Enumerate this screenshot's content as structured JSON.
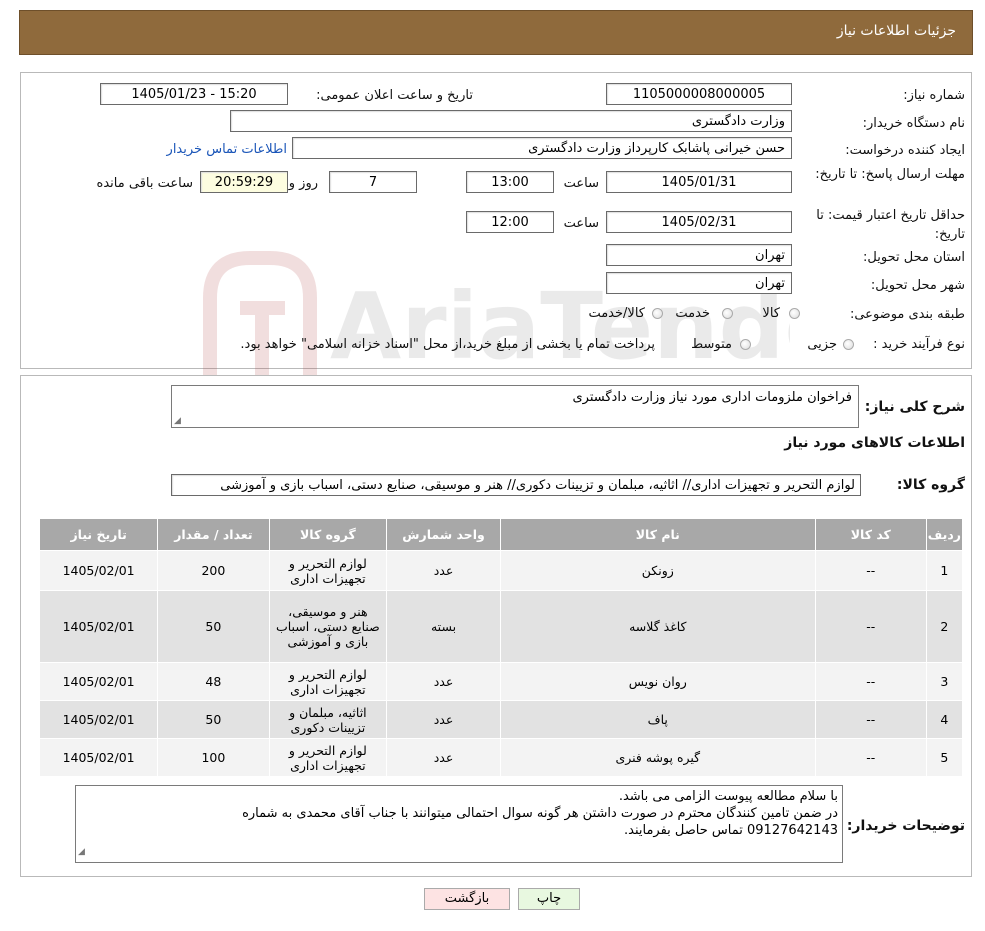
{
  "header": {
    "title": "جزئیات اطلاعات نیاز"
  },
  "watermark": {
    "text": "AriaTender.neT"
  },
  "form": {
    "need_number_label": "شماره نیاز:",
    "need_number": "1105000008000005",
    "announce_label": "تاریخ و ساعت اعلان عمومی:",
    "announce_value": "1405/01/23 - 15:20",
    "buyer_label": "نام دستگاه خریدار:",
    "buyer_value": "وزارت دادگستری",
    "requester_label": "ایجاد کننده درخواست:",
    "requester_value": "حسن خیرانی پاشابک کارپرداز وزارت دادگستری",
    "contact_link": "اطلاعات تماس خریدار",
    "deadline_label": "مهلت ارسال پاسخ: تا تاریخ:",
    "deadline_date": "1405/01/31",
    "time_label": "ساعت",
    "deadline_time": "13:00",
    "days_value": "7",
    "days_label": "روز و",
    "remaining_time": "20:59:29",
    "remaining_label": "ساعت باقی مانده",
    "validity_label": "حداقل تاریخ اعتبار قیمت: تا تاریخ:",
    "validity_date": "1405/02/31",
    "validity_time": "12:00",
    "province_label": "استان محل تحویل:",
    "province_value": "تهران",
    "city_label": "شهر محل تحویل:",
    "city_value": "تهران",
    "category_label": "طبقه بندی موضوعی:",
    "category_options": [
      "کالا",
      "خدمت",
      "کالا/خدمت"
    ],
    "process_label": "نوع فرآیند خرید :",
    "process_options": [
      "جزیی",
      "متوسط"
    ],
    "process_note": "پرداخت تمام یا بخشی از مبلغ خرید،از محل \"اسناد خزانه اسلامی\" خواهد بود."
  },
  "summary": {
    "description_label": "شرح کلی نیاز:",
    "description_value": "فراخوان ملزومات اداری مورد نیاز وزارت دادگستری",
    "goods_info_title": "اطلاعات کالاهای مورد نیاز",
    "goods_group_label": "گروه کالا:",
    "goods_group_value": "لوازم التحریر و تجهیزات اداری// اثاثیه، مبلمان و تزیینات دکوری// هنر و موسیقی، صنایع دستی، اسباب بازی و آموزشی"
  },
  "table": {
    "headers": [
      "ردیف",
      "کد کالا",
      "نام کالا",
      "واحد شمارش",
      "گروه کالا",
      "تعداد / مقدار",
      "تاریخ نیاز"
    ],
    "rows": [
      [
        "1",
        "--",
        "زونکن",
        "عدد",
        "لوازم التحریر و تجهیزات اداری",
        "200",
        "1405/02/01"
      ],
      [
        "2",
        "--",
        "کاغذ گلاسه",
        "بسته",
        "هنر و موسیقی، صنایع دستی، اسباب بازی و آموزشی",
        "50",
        "1405/02/01"
      ],
      [
        "3",
        "--",
        "روان نویس",
        "عدد",
        "لوازم التحریر و تجهیزات اداری",
        "48",
        "1405/02/01"
      ],
      [
        "4",
        "--",
        "پاف",
        "عدد",
        "اثاثیه، مبلمان و تزیینات دکوری",
        "50",
        "1405/02/01"
      ],
      [
        "5",
        "--",
        "گیره پوشه فنری",
        "عدد",
        "لوازم التحریر و تجهیزات اداری",
        "100",
        "1405/02/01"
      ]
    ]
  },
  "notes": {
    "label": "توضیحات خریدار:",
    "line1": "با سلام مطالعه پیوست الزامی می باشد.",
    "line2": "در ضمن تامین کنندگان محترم در صورت داشتن هر گونه سوال احتمالی میتوانند با جناب آقای محمدی به شماره",
    "line3": "09127642143 تماس حاصل بفرمایند."
  },
  "buttons": {
    "print": "چاپ",
    "back": "بازگشت"
  },
  "colors": {
    "header_bg": "#8f6a3c",
    "link": "#1a55b8",
    "table_header": "#a8a8a8",
    "back_button": "#fde3e3",
    "print_button": "#e8f8e0"
  }
}
